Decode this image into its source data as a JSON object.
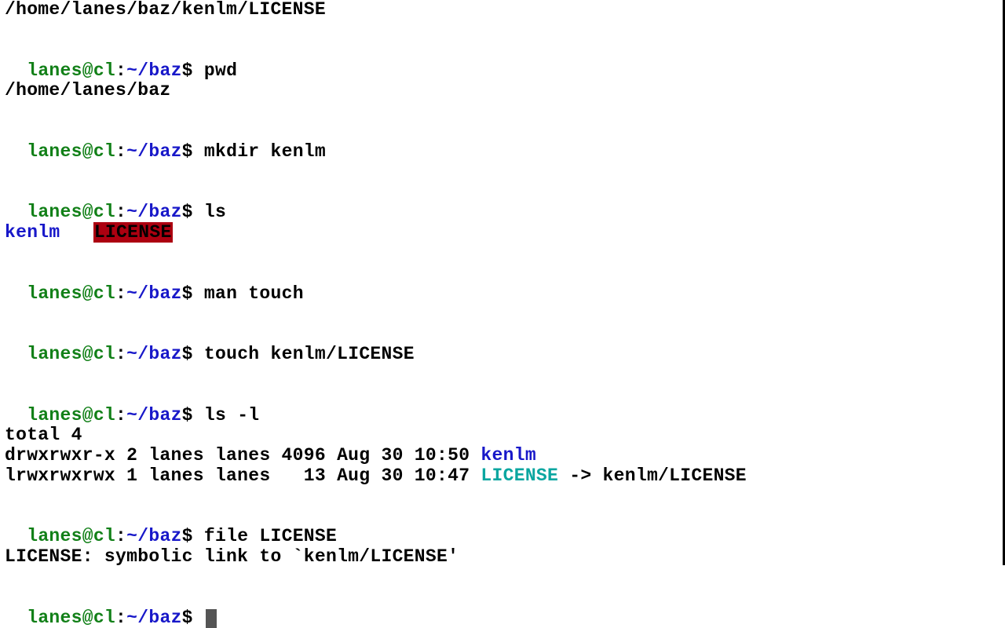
{
  "prompt": {
    "user_host": "lanes@cl",
    "sep": ":",
    "path": "~/baz",
    "dollar": "$ "
  },
  "top_output": "/home/lanes/baz/kenlm/LICENSE",
  "cmd_pwd": "pwd",
  "out_pwd": "/home/lanes/baz",
  "cmd_mkdir": "mkdir kenlm",
  "cmd_ls": "ls",
  "ls_out": {
    "dir": "kenlm",
    "gap": "   ",
    "symlink": "LICENSE"
  },
  "cmd_man": "man touch",
  "cmd_touch": "touch kenlm/LICENSE",
  "cmd_lsl": "ls -l",
  "lsl": {
    "total": "total 4",
    "row1_pre": "drwxrwxr-x 2 lanes lanes 4096 Aug 30 10:50 ",
    "row1_name": "kenlm",
    "row2_pre": "lrwxrwxrwx 1 lanes lanes   13 Aug 30 10:47 ",
    "row2_name": "LICENSE",
    "row2_arrow": " -> ",
    "row2_target": "kenlm/LICENSE"
  },
  "cmd_file": "file LICENSE",
  "out_file": "LICENSE: symbolic link to `kenlm/LICENSE'"
}
